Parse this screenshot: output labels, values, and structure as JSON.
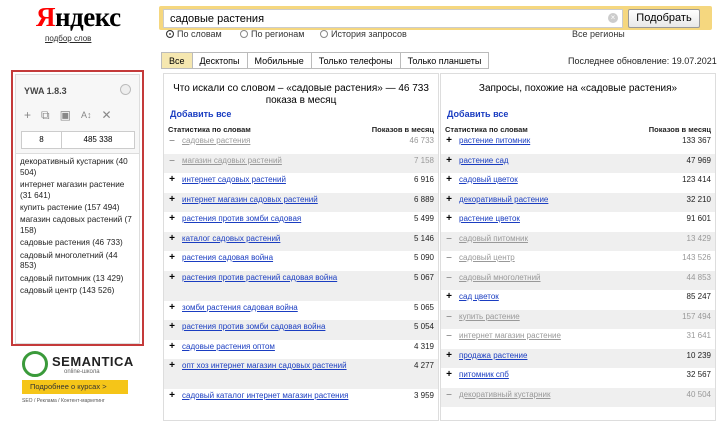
{
  "header": {
    "logo_first": "Я",
    "logo_rest": "ндекс",
    "sublink": "подбор слов",
    "search_value": "садовые растения",
    "search_button": "Подобрать",
    "radios": [
      "По словам",
      "По регионам",
      "История запросов"
    ],
    "regions": "Все регионы"
  },
  "tabs": [
    "Все",
    "Десктопы",
    "Мобильные",
    "Только телефоны",
    "Только планшеты"
  ],
  "updated": "Последнее обновление: 19.07.2021",
  "ywa": {
    "title": "YWA 1.8.3",
    "count_left": "8",
    "count_right": "485 338",
    "items": [
      "декоративный кустарник (40 504)",
      "интернет магазин растение (31 641)",
      "купить растение (157 494)",
      "магазин садовых растений (7 158)",
      "садовые растения (46 733)",
      "садовый многолетний (44 853)",
      "садовый питомник (13 429)",
      "садовый центр (143 526)"
    ]
  },
  "semantica": {
    "name": "SEMANTICA",
    "sub": "online-школа",
    "button": "Подробнее о курсах >",
    "foot": "SEO / Реклама / Контент-маркетинг"
  },
  "left": {
    "heading": "Что искали со словом – «садовые растения» — 46 733 показа в месяц",
    "add_all": "Добавить все",
    "col_kw": "Статистика по словам",
    "col_views": "Показов в месяц",
    "rows": [
      {
        "sym": "–",
        "kw": "садовые растения",
        "val": "46 733",
        "muted": true
      },
      {
        "sym": "–",
        "kw": "магазин садовых растений",
        "val": "7 158",
        "muted": true
      },
      {
        "sym": "+",
        "kw": "интернет садовых растений",
        "val": "6 916",
        "muted": false
      },
      {
        "sym": "+",
        "kw": "интернет магазин садовых растений",
        "val": "6 889",
        "muted": false
      },
      {
        "sym": "+",
        "kw": "растения против зомби садовая",
        "val": "5 499",
        "muted": false
      },
      {
        "sym": "+",
        "kw": "каталог садовых растений",
        "val": "5 146",
        "muted": false
      },
      {
        "sym": "+",
        "kw": "растения садовая война",
        "val": "5 090",
        "muted": false
      },
      {
        "sym": "+",
        "kw": "растения против растений садовая война",
        "val": "5 067",
        "muted": false
      },
      {
        "sym": "+",
        "kw": "зомби растения садовая война",
        "val": "5 065",
        "muted": false
      },
      {
        "sym": "+",
        "kw": "растения против зомби садовая война",
        "val": "5 054",
        "muted": false
      },
      {
        "sym": "+",
        "kw": "садовые растения оптом",
        "val": "4 319",
        "muted": false
      },
      {
        "sym": "+",
        "kw": "опт хоз интернет магазин садовых растений",
        "val": "4 277",
        "muted": false
      },
      {
        "sym": "+",
        "kw": "садовый каталог интернет магазин растения",
        "val": "3 959",
        "muted": false
      }
    ]
  },
  "right": {
    "heading": "Запросы, похожие на «садовые растения»",
    "add_all": "Добавить все",
    "col_kw": "Статистика по словам",
    "col_views": "Показов в месяц",
    "rows": [
      {
        "sym": "+",
        "kw": "растение питомник",
        "val": "133 367",
        "muted": false
      },
      {
        "sym": "+",
        "kw": "растение сад",
        "val": "47 969",
        "muted": false
      },
      {
        "sym": "+",
        "kw": "садовый цветок",
        "val": "123 414",
        "muted": false
      },
      {
        "sym": "+",
        "kw": "декоративный растение",
        "val": "32 210",
        "muted": false
      },
      {
        "sym": "+",
        "kw": "растение цветок",
        "val": "91 601",
        "muted": false
      },
      {
        "sym": "–",
        "kw": "садовый питомник",
        "val": "13 429",
        "muted": true
      },
      {
        "sym": "–",
        "kw": "садовый центр",
        "val": "143 526",
        "muted": true
      },
      {
        "sym": "–",
        "kw": "садовый многолетний",
        "val": "44 853",
        "muted": true
      },
      {
        "sym": "+",
        "kw": "сад цветок",
        "val": "85 247",
        "muted": false
      },
      {
        "sym": "–",
        "kw": "купить растение",
        "val": "157 494",
        "muted": true
      },
      {
        "sym": "–",
        "kw": "интернет магазин растение",
        "val": "31 641",
        "muted": true
      },
      {
        "sym": "+",
        "kw": "продажа растение",
        "val": "10 239",
        "muted": false
      },
      {
        "sym": "+",
        "kw": "питомник спб",
        "val": "32 567",
        "muted": false
      },
      {
        "sym": "–",
        "kw": "декоративный кустарник",
        "val": "40 504",
        "muted": true
      }
    ]
  }
}
